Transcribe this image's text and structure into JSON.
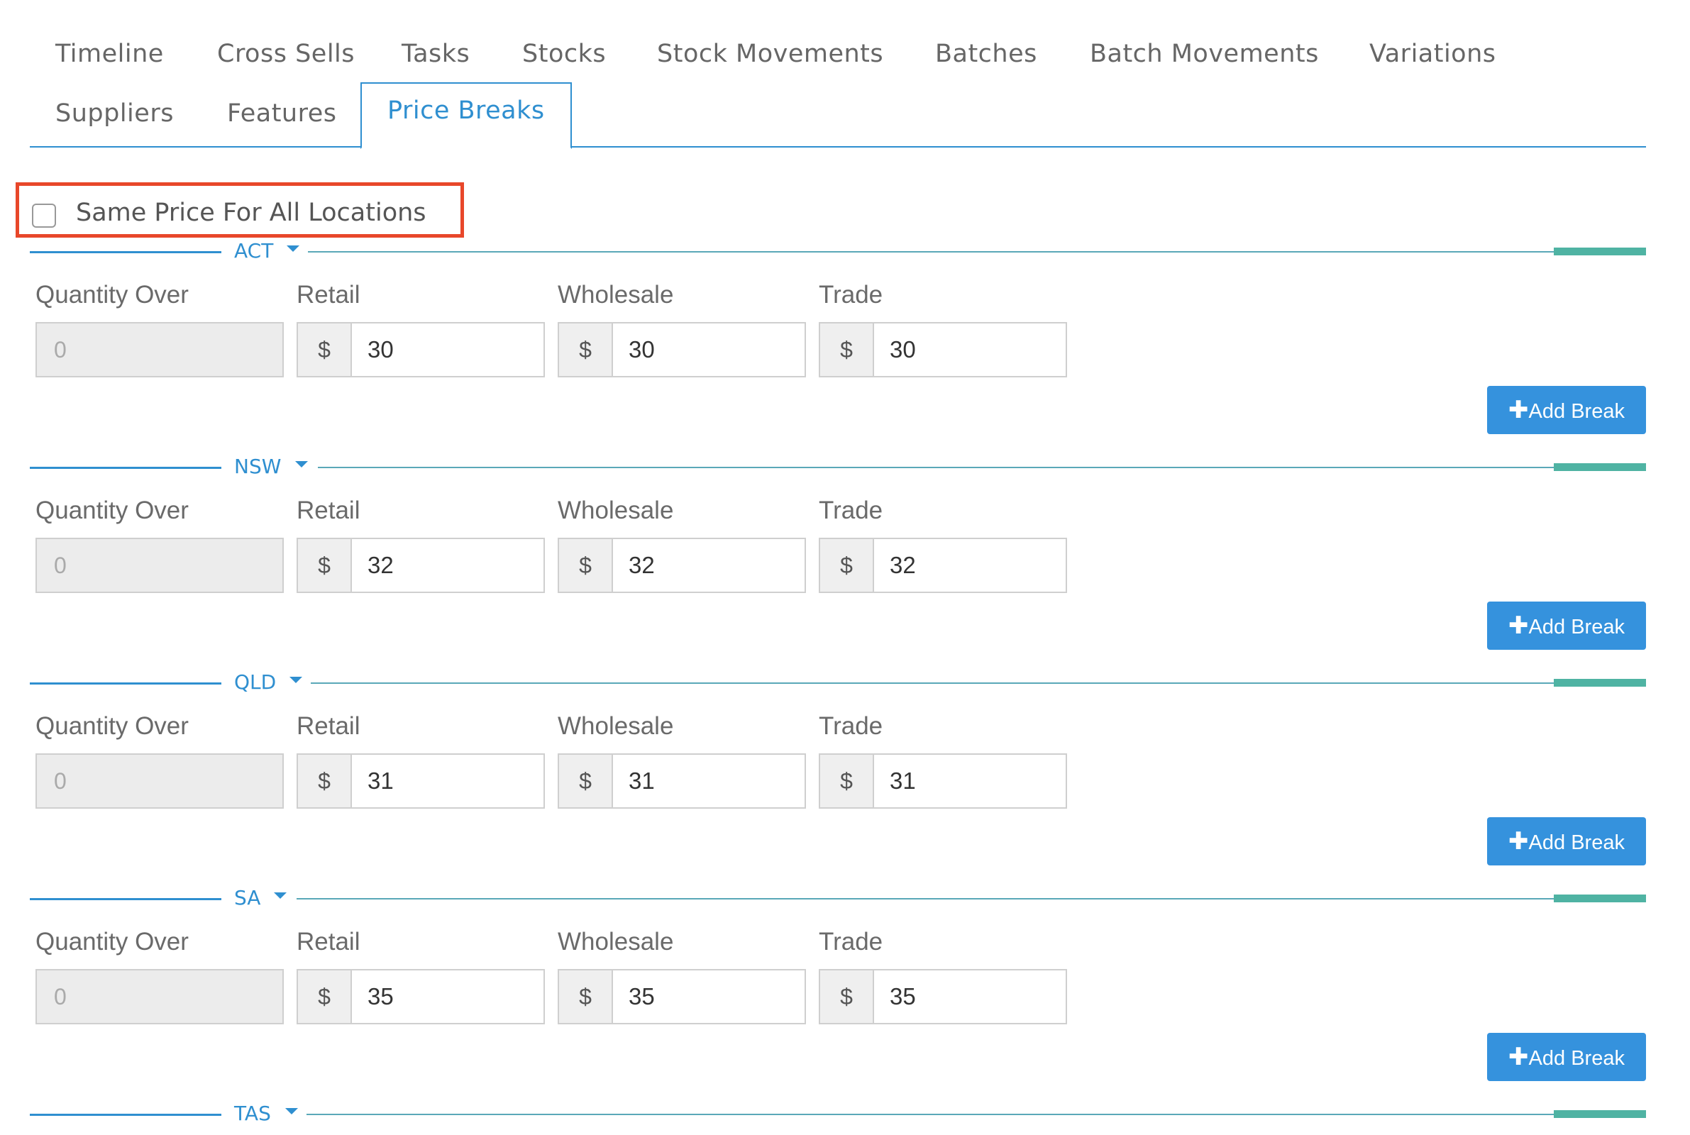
{
  "tabs": [
    {
      "label": "Timeline"
    },
    {
      "label": "Cross Sells"
    },
    {
      "label": "Tasks"
    },
    {
      "label": "Stocks"
    },
    {
      "label": "Stock Movements"
    },
    {
      "label": "Batches"
    },
    {
      "label": "Batch Movements"
    },
    {
      "label": "Variations"
    },
    {
      "label": "Suppliers"
    },
    {
      "label": "Features"
    },
    {
      "label": "Price Breaks",
      "active": true
    }
  ],
  "same_price": {
    "label": "Same Price For All Locations",
    "checked": false
  },
  "columns": {
    "quantity_over": "Quantity Over",
    "retail": "Retail",
    "wholesale": "Wholesale",
    "trade": "Trade"
  },
  "currency_symbol": "$",
  "add_break_label": "Add Break",
  "locations": [
    {
      "name": "ACT",
      "quantity_over": "0",
      "retail": "30",
      "wholesale": "30",
      "trade": "30"
    },
    {
      "name": "NSW",
      "quantity_over": "0",
      "retail": "32",
      "wholesale": "32",
      "trade": "32"
    },
    {
      "name": "QLD",
      "quantity_over": "0",
      "retail": "31",
      "wholesale": "31",
      "trade": "31"
    },
    {
      "name": "SA",
      "quantity_over": "0",
      "retail": "35",
      "wholesale": "35",
      "trade": "35"
    },
    {
      "name": "TAS"
    }
  ],
  "colors": {
    "accent": "#2f8fd0",
    "button": "#3592dd",
    "highlight_box": "#e8472a",
    "teal": "#4fb3a3"
  }
}
